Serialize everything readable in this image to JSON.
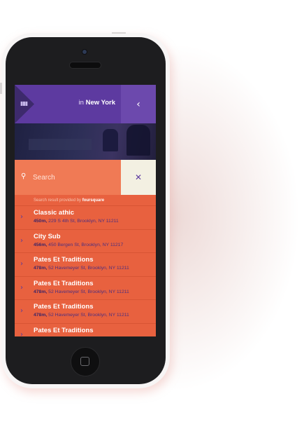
{
  "header": {
    "title_prefix": "in",
    "city": "New York",
    "menu_icon": "menu-icon",
    "back_icon": "chevron-left-icon"
  },
  "search": {
    "placeholder": "Search",
    "value": "",
    "clear_icon": "close-icon"
  },
  "provider": {
    "text": "Search result provided by",
    "brand": "foursquare"
  },
  "results": [
    {
      "name": "Classic athic",
      "distance": "450m,",
      "address": "229 S 4th St, Brooklyn, NY 11211"
    },
    {
      "name": "City Sub",
      "distance": "456m,",
      "address": "450 Bergen St, Brooklyn, NY 11217"
    },
    {
      "name": "Pates Et Traditions",
      "distance": "478m,",
      "address": "52 Havemeyer St, Brooklyn, NY 11211"
    },
    {
      "name": "Pates Et Traditions",
      "distance": "478m,",
      "address": "52 Havemeyer St, Brooklyn, NY 11211"
    },
    {
      "name": "Pates Et Traditions",
      "distance": "478m,",
      "address": "52 Havemeyer St, Brooklyn, NY 11211"
    },
    {
      "name": "Pates Et Traditions",
      "distance": "",
      "address": ""
    }
  ],
  "colors": {
    "header": "#5d3aa0",
    "accent": "#e8613f",
    "search_bar": "#f07a55",
    "clear_button": "#f3f0e2"
  }
}
